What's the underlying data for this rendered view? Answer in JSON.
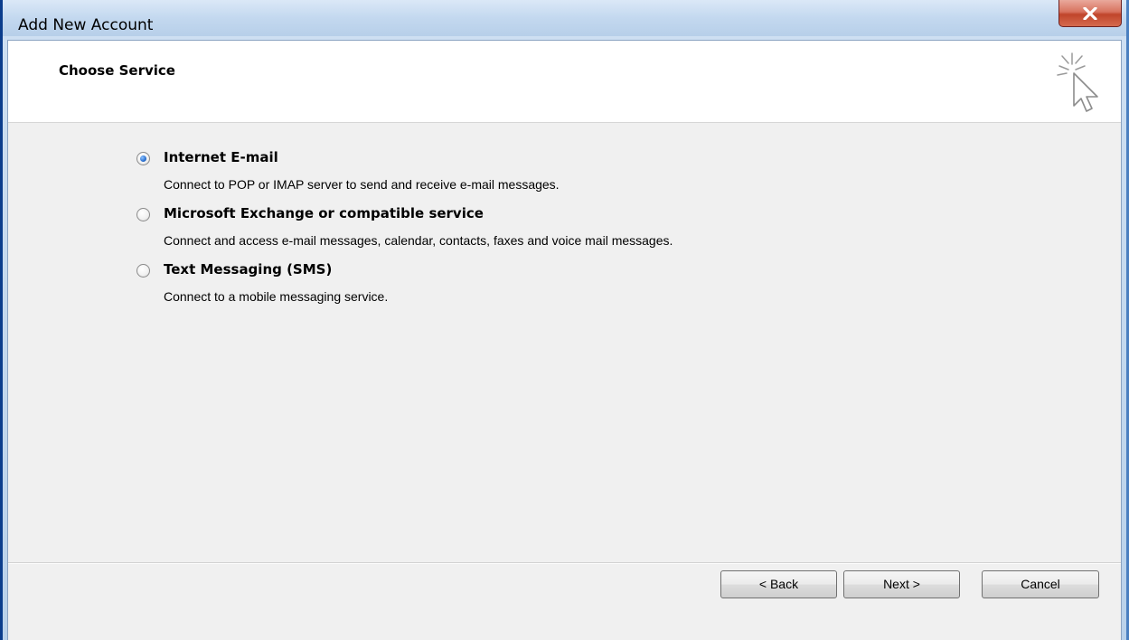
{
  "window": {
    "title": "Add New Account",
    "close_icon": "close-x-icon"
  },
  "header": {
    "title": "Choose Service",
    "icon": "wizard-cursor-sparkle-icon"
  },
  "options": [
    {
      "label": "Internet E-mail",
      "description": "Connect to POP or IMAP server to send and receive e-mail messages.",
      "selected": true
    },
    {
      "label": "Microsoft Exchange or compatible service",
      "description": "Connect and access e-mail messages, calendar, contacts, faxes and voice mail messages.",
      "selected": false
    },
    {
      "label": "Text Messaging (SMS)",
      "description": "Connect to a mobile messaging service.",
      "selected": false
    }
  ],
  "buttons": {
    "back": "< Back",
    "next": "Next >",
    "cancel": "Cancel"
  },
  "colors": {
    "title_bar": "#c3d8ef",
    "close_button": "#c0452b",
    "dialog_background": "#f0f0f0",
    "header_background": "#ffffff"
  }
}
